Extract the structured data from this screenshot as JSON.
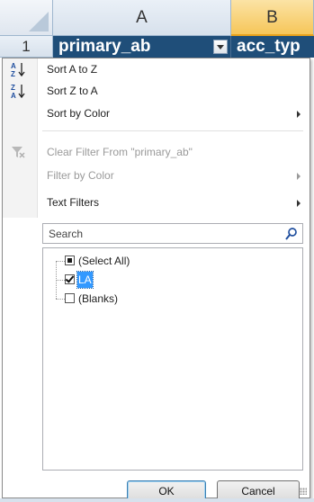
{
  "sheet": {
    "col_a": "A",
    "col_b": "B",
    "row_1": "1",
    "cell_a1": "primary_ab",
    "cell_b1": "acc_typ"
  },
  "menu": {
    "sort_az": "Sort A to Z",
    "sort_za": "Sort Z to A",
    "sort_color": "Sort by Color",
    "clear_filter": "Clear Filter From \"primary_ab\"",
    "filter_color": "Filter by Color",
    "text_filters": "Text Filters"
  },
  "search": {
    "placeholder": "Search"
  },
  "list": {
    "select_all": "(Select All)",
    "la": "LA",
    "blanks": "(Blanks)"
  },
  "buttons": {
    "ok": "OK",
    "cancel": "Cancel"
  },
  "colors": {
    "header_cell": "#1f4e79",
    "selected_col_header": "#f6c659",
    "selection_highlight": "#3399ff"
  }
}
